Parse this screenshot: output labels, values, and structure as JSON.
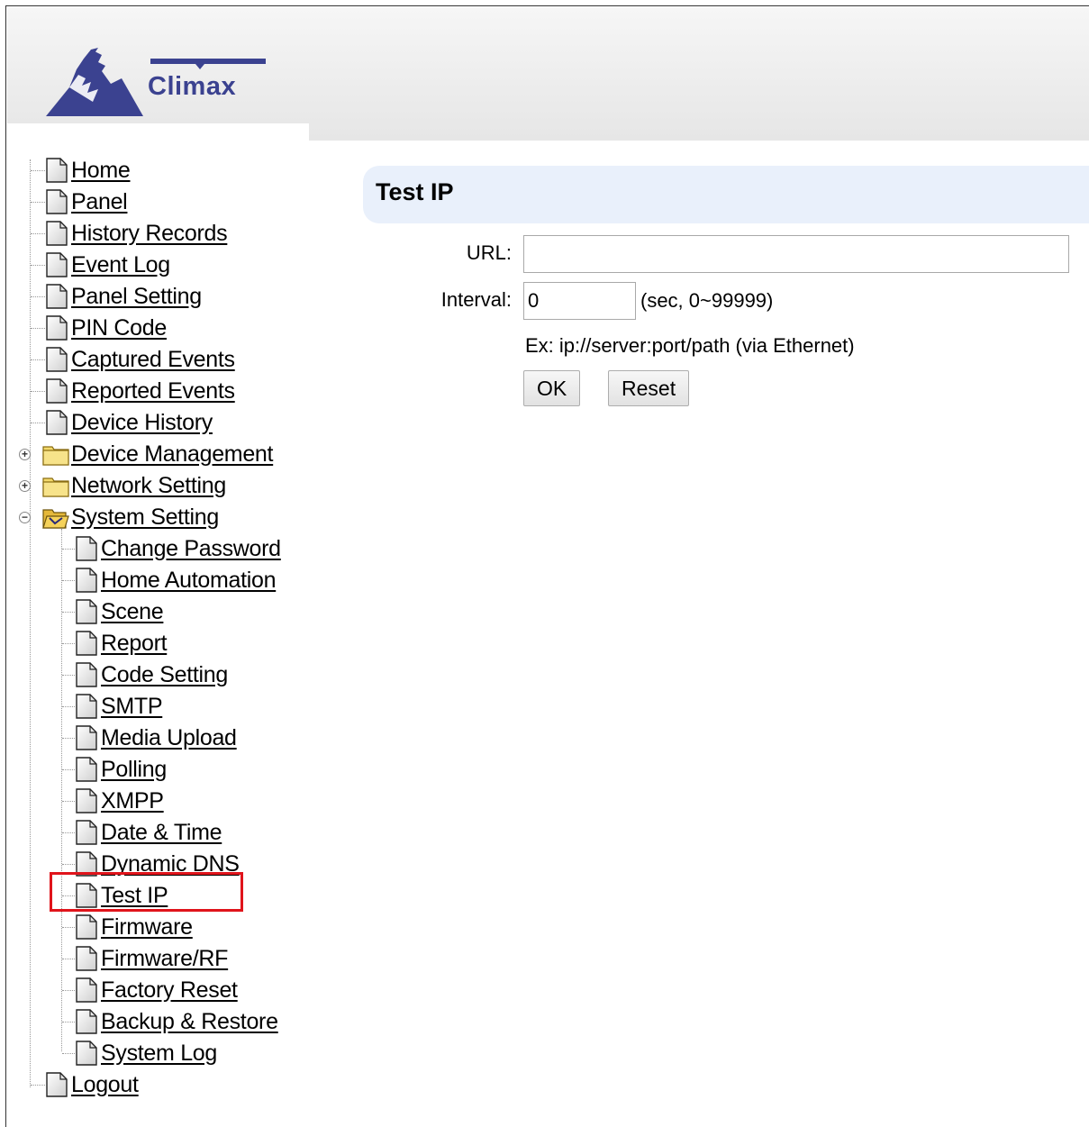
{
  "brand": {
    "logo_text": "Climax"
  },
  "sidebar": {
    "top_items": [
      {
        "label": "Home"
      },
      {
        "label": "Panel"
      },
      {
        "label": "History Records"
      },
      {
        "label": "Event Log"
      },
      {
        "label": "Panel Setting"
      },
      {
        "label": "PIN Code"
      },
      {
        "label": "Captured Events"
      },
      {
        "label": "Reported Events"
      },
      {
        "label": "Device History"
      }
    ],
    "folders": [
      {
        "label": "Device Management",
        "expanded": false
      },
      {
        "label": "Network Setting",
        "expanded": false
      },
      {
        "label": "System Setting",
        "expanded": true
      }
    ],
    "system_items": [
      {
        "label": "Change Password"
      },
      {
        "label": "Home Automation"
      },
      {
        "label": "Scene"
      },
      {
        "label": "Report"
      },
      {
        "label": "Code Setting"
      },
      {
        "label": "SMTP"
      },
      {
        "label": "Media Upload"
      },
      {
        "label": "Polling"
      },
      {
        "label": "XMPP"
      },
      {
        "label": "Date & Time"
      },
      {
        "label": "Dynamic DNS"
      },
      {
        "label": "Test IP",
        "selected": true
      },
      {
        "label": "Firmware"
      },
      {
        "label": "Firmware/RF"
      },
      {
        "label": "Factory Reset"
      },
      {
        "label": "Backup & Restore"
      },
      {
        "label": "System Log"
      }
    ],
    "logout": {
      "label": "Logout"
    }
  },
  "main": {
    "title": "Test IP",
    "url_label": "URL:",
    "url_value": "",
    "interval_label": "Interval:",
    "interval_value": "0",
    "interval_hint": "(sec, 0~99999)",
    "example": "Ex: ip://server:port/path (via Ethernet)",
    "ok_label": "OK",
    "reset_label": "Reset"
  },
  "colors": {
    "title_bar": "#e9f0fb",
    "highlight": "#e0141b",
    "logo": "#3b4290"
  }
}
